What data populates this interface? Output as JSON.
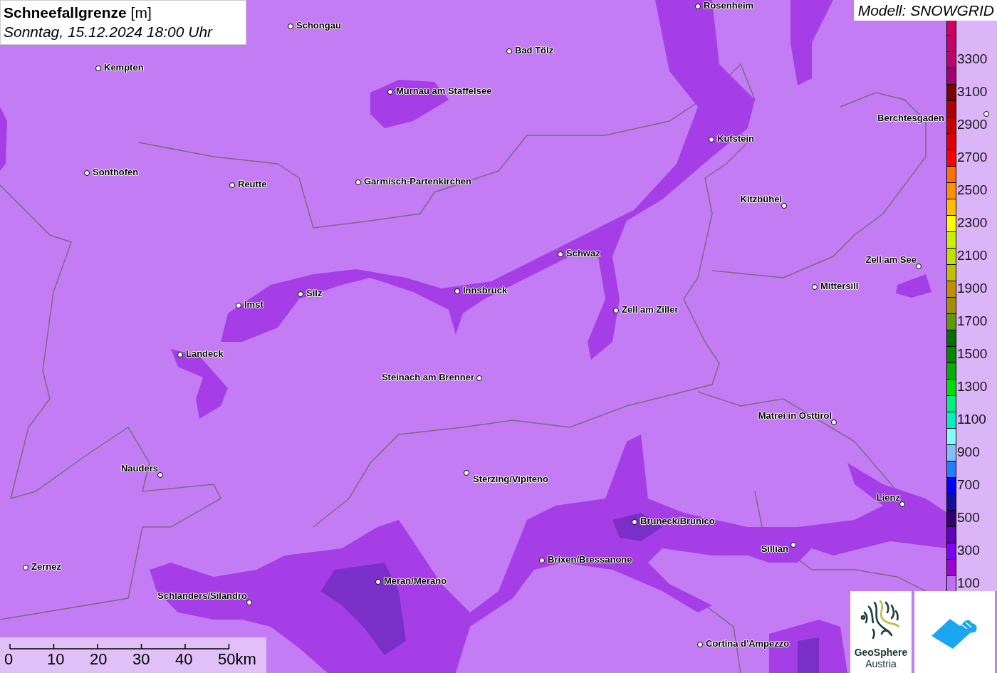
{
  "title": {
    "heading": "**Schneefallgrenze** [m]",
    "datetime": "Sonntag, 15.12.2024 18:00 Uhr"
  },
  "model": "Modell: SNOWGRID",
  "cities": [
    {
      "name": "Rosenheim"
    },
    {
      "name": "Schongau"
    },
    {
      "name": "Bad Tölz"
    },
    {
      "name": "Kempten"
    },
    {
      "name": "Murnau am Staffelsee"
    },
    {
      "name": "Berchtesgaden"
    },
    {
      "name": "Kufstein"
    },
    {
      "name": "Sonthofen"
    },
    {
      "name": "Reutte"
    },
    {
      "name": "Garmisch-Partenkirchen"
    },
    {
      "name": "Kitzbühel"
    },
    {
      "name": "Schwaz"
    },
    {
      "name": "Zell am See"
    },
    {
      "name": "Mittersill"
    },
    {
      "name": "Innsbruck"
    },
    {
      "name": "Silz"
    },
    {
      "name": "Imst"
    },
    {
      "name": "Zell am Ziller"
    },
    {
      "name": "Landeck"
    },
    {
      "name": "Steinach am Brenner"
    },
    {
      "name": "Matrei in Osttirol"
    },
    {
      "name": "Nauders"
    },
    {
      "name": "Sterzing/Vipiteno"
    },
    {
      "name": "Bruneck/Brunico"
    },
    {
      "name": "Lienz"
    },
    {
      "name": "Brixen/Bressanone"
    },
    {
      "name": "Sillian"
    },
    {
      "name": "Zernez"
    },
    {
      "name": "Meran/Merano"
    },
    {
      "name": "Schlanders/Silandro"
    },
    {
      "name": "Cortina d'Ampezzo"
    }
  ],
  "legend": [
    {
      "color": "#d00060"
    },
    {
      "color": "#c8006a"
    },
    {
      "color": "#c00070",
      "label": "3300"
    },
    {
      "color": "#a00070"
    },
    {
      "color": "#800000",
      "label": "3100"
    },
    {
      "color": "#b00000"
    },
    {
      "color": "#c80000",
      "label": "2900"
    },
    {
      "color": "#e00000"
    },
    {
      "color": "#ff0000",
      "label": "2700"
    },
    {
      "color": "#ff7000"
    },
    {
      "color": "#ff9000",
      "label": "2500"
    },
    {
      "color": "#ffc000"
    },
    {
      "color": "#ffff00",
      "label": "2300"
    },
    {
      "color": "#c8f000"
    },
    {
      "color": "#c0e000",
      "label": "2100"
    },
    {
      "color": "#c0c000"
    },
    {
      "color": "#c09000",
      "label": "1900"
    },
    {
      "color": "#a09000"
    },
    {
      "color": "#609900",
      "label": "1700"
    },
    {
      "color": "#007000"
    },
    {
      "color": "#008800",
      "label": "1500"
    },
    {
      "color": "#00b000"
    },
    {
      "color": "#00e000",
      "label": "1300"
    },
    {
      "color": "#00f080"
    },
    {
      "color": "#00f0c0",
      "label": "1100"
    },
    {
      "color": "#80ffff"
    },
    {
      "color": "#80c0ff",
      "label": "900"
    },
    {
      "color": "#2080ff"
    },
    {
      "color": "#0000ff",
      "label": "700"
    },
    {
      "color": "#1010a0"
    },
    {
      "color": "#300070",
      "label": "500"
    },
    {
      "color": "#6000c0"
    },
    {
      "color": "#8000ff",
      "label": "300"
    },
    {
      "color": "#a000d0"
    },
    {
      "color": "#c070f0",
      "label": "100"
    }
  ],
  "scale_bar": [
    "0",
    "10",
    "20",
    "30",
    "40",
    "50km"
  ],
  "logo": {
    "name": "GeoSphere",
    "country": "Austria"
  }
}
